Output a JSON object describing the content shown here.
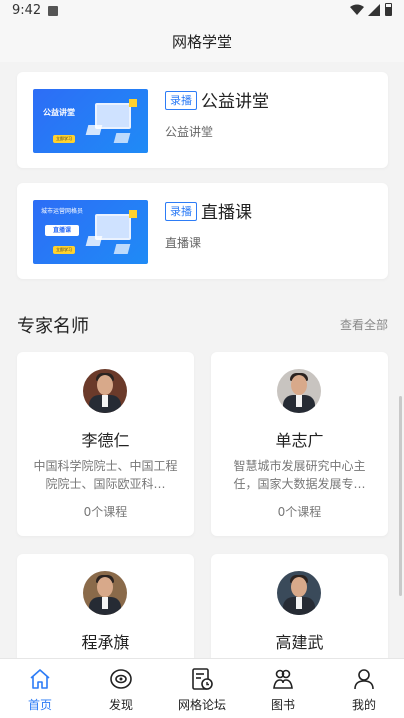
{
  "status_bar": {
    "time": "9:42"
  },
  "header": {
    "title": "网格学堂"
  },
  "courses": [
    {
      "tag": "录播",
      "title": "公益讲堂",
      "subtitle": "公益讲堂",
      "thumb_text": "公益讲堂",
      "thumb_btn": "立即学习"
    },
    {
      "tag": "录播",
      "title": "直播课",
      "subtitle": "直播课",
      "thumb_text": "城市运营网格员",
      "thumb_pill": "直播课",
      "thumb_btn": "立即学习"
    }
  ],
  "experts_section": {
    "title": "专家名师",
    "more": "查看全部"
  },
  "experts": [
    {
      "name": "李德仁",
      "desc": "中国科学院院士、中国工程院院士、国际欧亚科…",
      "count": "0个课程"
    },
    {
      "name": "单志广",
      "desc": "智慧城市发展研究中心主任，国家大数据发展专…",
      "count": "0个课程"
    },
    {
      "name": "程承旗",
      "desc": "",
      "count": ""
    },
    {
      "name": "高建武",
      "desc": "",
      "count": ""
    }
  ],
  "tabs": [
    {
      "label": "首页",
      "icon": "home-icon",
      "active": true
    },
    {
      "label": "发现",
      "icon": "eye-icon",
      "active": false
    },
    {
      "label": "网格论坛",
      "icon": "forum-icon",
      "active": false
    },
    {
      "label": "图书",
      "icon": "book-icon",
      "active": false
    },
    {
      "label": "我的",
      "icon": "user-icon",
      "active": false
    }
  ],
  "colors": {
    "accent": "#2d7cf6",
    "background": "#f3f3f3",
    "card": "#ffffff"
  }
}
